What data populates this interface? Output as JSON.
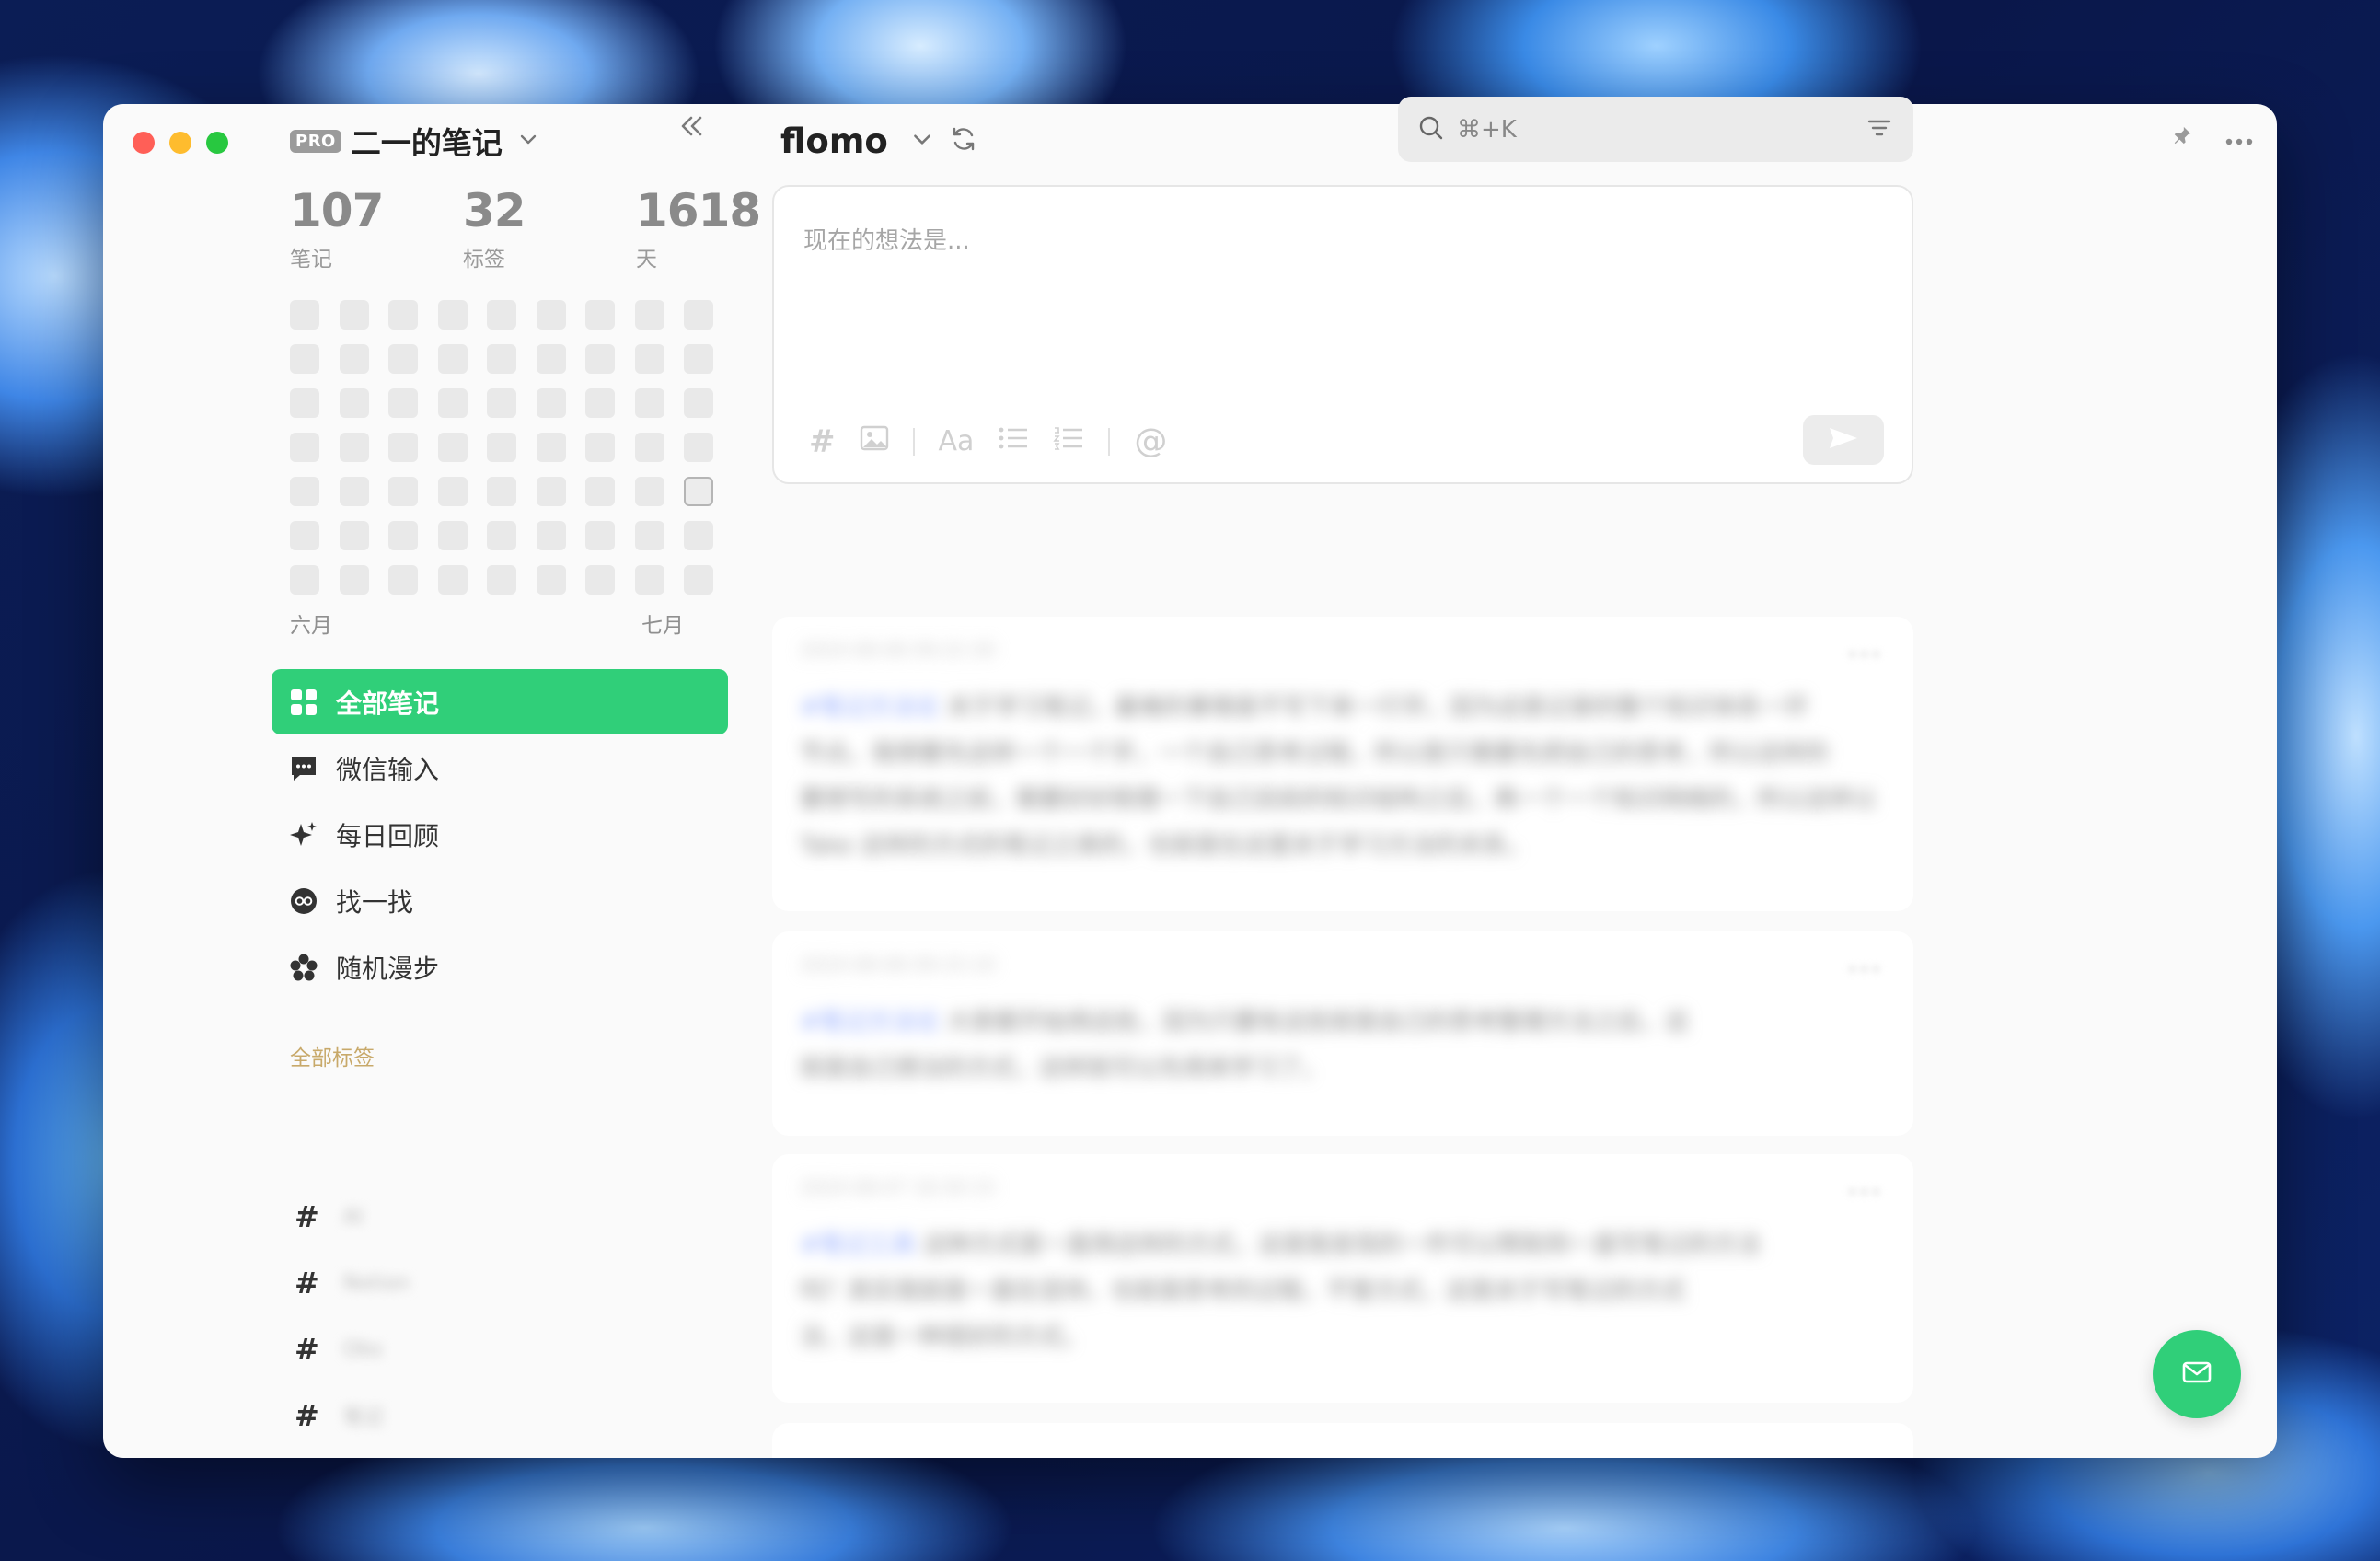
{
  "window": {
    "colors": {
      "accent": "#30cf79",
      "tag_title": "#c8a96a"
    }
  },
  "sidebar": {
    "pro_badge": "PRO",
    "user_name": "二一的笔记",
    "stats": [
      {
        "value": "107",
        "label": "笔记"
      },
      {
        "value": "32",
        "label": "标签"
      },
      {
        "value": "1618",
        "label": "天"
      }
    ],
    "heatmap_months": [
      "六月",
      "七月"
    ],
    "nav": [
      {
        "label": "全部笔记",
        "icon": "grid-icon"
      },
      {
        "label": "微信输入",
        "icon": "chat-icon"
      },
      {
        "label": "每日回顾",
        "icon": "sparkle-icon"
      },
      {
        "label": "找一找",
        "icon": "glasses-icon"
      },
      {
        "label": "随机漫步",
        "icon": "flower-icon"
      }
    ],
    "tags_title": "全部标签",
    "tags": [
      {
        "hash": "#",
        "name": "AI"
      },
      {
        "hash": "#",
        "name": "Notion"
      },
      {
        "hash": "#",
        "name": "Obs"
      },
      {
        "hash": "#",
        "name": "笔记"
      }
    ]
  },
  "main": {
    "brand": "flomo",
    "search": {
      "shortcut": "⌘+K"
    },
    "editor": {
      "placeholder": "现在的想法是..."
    },
    "cards": [
      {
        "time": "2024-08-08 09:22:30",
        "lines": [
          {
            "tag": "#笔记方法论",
            "text": "关于学习笔记，最难的事情是不写下来一行字。因为这是记录的整个知识体系一环"
          },
          {
            "tag": "",
            "text": "节点。我想要先这样一个一个字，一个自己思考过程，所以是只需要先把自己的思考，所以这样的"
          },
          {
            "tag": "",
            "text": "要想写的系统之前，需要好好梳理一下自己目前的知识结构之后，再一个一个知识网络的，所以这样以"
          },
          {
            "tag": "",
            "text": "Take 这样的方式的笔记之类的，也就是在这里关于学习方法的关系。"
          }
        ]
      },
      {
        "time": "2024-08-08 09:15:10",
        "lines": [
          {
            "tag": "#笔记方法论",
            "text": "大家都开始用这些，因为只要有这些就是自己的思考整理方法之后，这"
          },
          {
            "tag": "",
            "text": "就是自己想法的方式，这样就可以先用来学习了。"
          }
        ]
      },
      {
        "time": "2024-08-07 18:30:15",
        "lines": [
          {
            "tag": "#笔记工具",
            "text": "这种方式是一直用这样的方式，这是我发现的一件可以帮助到一直写笔记的方法"
          },
          {
            "tag": "",
            "text": "吗？其实我就是一直在坚持，也就是思考的过程，不管方式，这是关于写笔记的方式"
          },
          {
            "tag": "",
            "text": "法，这是一种很好的方式。"
          }
        ]
      }
    ]
  }
}
